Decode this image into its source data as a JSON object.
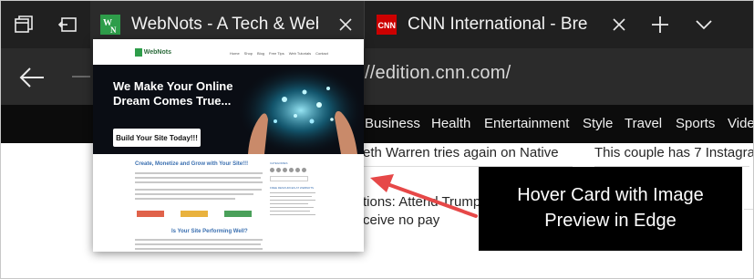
{
  "tabs": [
    {
      "title": "WebNots - A Tech & Web",
      "favicon": "webnots-favicon",
      "active": true
    },
    {
      "title": "CNN International - Bre",
      "favicon": "cnn-favicon",
      "active": false
    }
  ],
  "address_bar": {
    "url": "//edition.cnn.com/"
  },
  "cnn_nav": [
    "Business",
    "Health",
    "Entertainment",
    "Style",
    "Travel",
    "Sports",
    "Vide"
  ],
  "headlines": [
    "eth Warren tries again on Native",
    "This couple has 7 Instagra",
    "tions: Attend Trump",
    "ceive no pay"
  ],
  "hover_card": {
    "logo_text": "WebNots",
    "menu": [
      "Home",
      "Shop",
      "Blog",
      "Free Tips",
      "Web Tutorials",
      "Contact"
    ],
    "hero_heading_line1": "We Make Your Online",
    "hero_heading_line2": "Dream Comes True...",
    "hero_button": "Build Your Site Today!!!",
    "section_heading": "Create, Monetize and Grow with Your Site!!!",
    "sub_heading": "Is Your Site Performing Well?",
    "sidebar_label_1": "CATEGORIES",
    "sidebar_label_2": "FREE RESOURCES AT WEBNOTS"
  },
  "annotation": {
    "line1": "Hover Card with Image",
    "line2": "Preview in Edge"
  },
  "colors": {
    "tabstrip_bg": "#202020",
    "addressbar_bg": "#2b2b2b",
    "cnn_nav_bg": "#0c0c0c",
    "cnn_red": "#cc0000",
    "webnots_green": "#2e9d4a",
    "arrow_red": "#e64848"
  }
}
